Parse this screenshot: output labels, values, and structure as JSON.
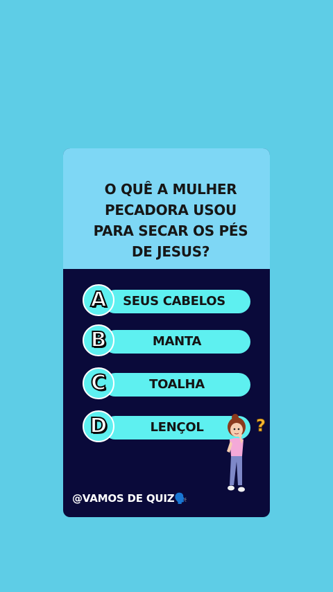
{
  "quiz": {
    "question": "O QUÊ A MULHER PECADORA USOU PARA SECAR OS PÉS DE JESUS?",
    "options": [
      {
        "letter": "A",
        "text": "SEUS CABELOS"
      },
      {
        "letter": "B",
        "text": "MANTA"
      },
      {
        "letter": "C",
        "text": "TOALHA"
      },
      {
        "letter": "D",
        "text": "LENÇOL"
      }
    ],
    "watermark": "@VAMOS DE QUIZ🗣️"
  },
  "colors": {
    "background": "#5ecde6",
    "question_box": "#7ed7f5",
    "card": "#0a0a3a",
    "pill": "#5ef0f0"
  },
  "icons": {
    "mascot": "girl-thinking-icon",
    "question_mark": "question-mark-icon"
  }
}
